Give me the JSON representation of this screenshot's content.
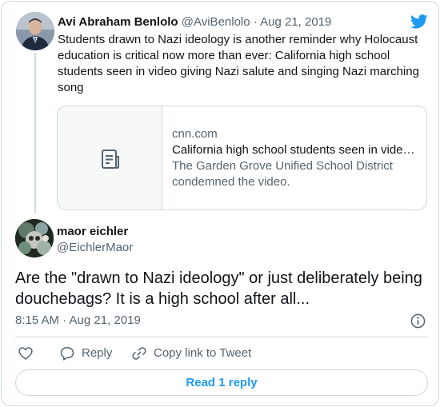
{
  "parent_tweet": {
    "author_name": "Avi Abraham Benlolo",
    "author_handle": "@AviBenlolo",
    "separator": "·",
    "date": "Aug 21, 2019",
    "text": "Students drawn to Nazi ideology is another reminder why Holocaust education is critical now more than ever: California high school students seen in video giving Nazi salute and singing Nazi marching song",
    "link_card": {
      "domain": "cnn.com",
      "title": "California high school students seen in vide…",
      "description": "The Garden Grove Unified School District condemned the video.",
      "thumbnail_icon": "document-icon"
    }
  },
  "main_tweet": {
    "author_name": "maor eichler",
    "author_handle": "@EichlerMaor",
    "text": "Are the \"drawn to Nazi ideology\" or just deliberately being douchebags? It is a high school after all...",
    "timestamp": "8:15 AM · Aug 21, 2019"
  },
  "actions": {
    "like_icon": "heart-icon",
    "reply_label": "Reply",
    "copy_label": "Copy link to Tweet"
  },
  "read_replies_label": "Read 1 reply",
  "colors": {
    "accent": "#1d9bf0",
    "text_primary": "#0f1419",
    "text_secondary": "#536471",
    "border": "#cfd9de"
  }
}
